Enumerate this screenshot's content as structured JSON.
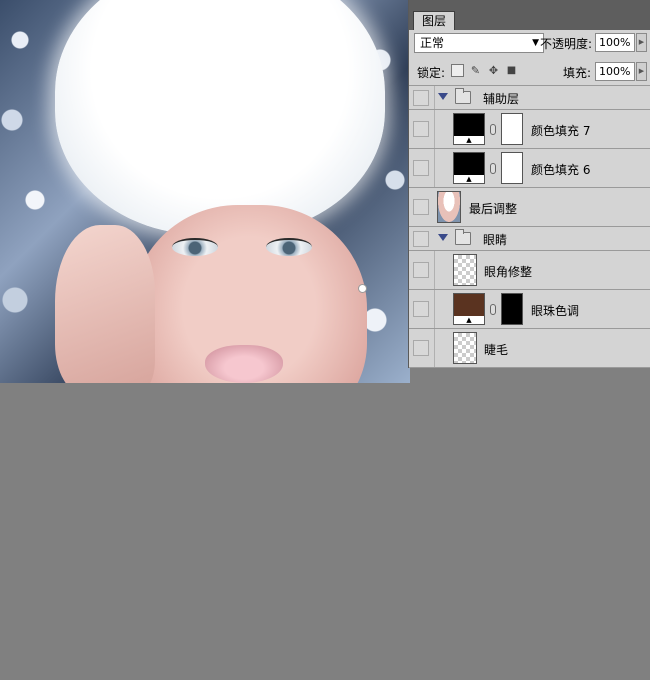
{
  "panel": {
    "tab_label": "图层",
    "blend_mode": "正常",
    "opacity_label": "不透明度:",
    "opacity_value": "100%",
    "lock_label": "锁定:",
    "fill_label": "填充:",
    "fill_value": "100%"
  },
  "layers": [
    {
      "name": "辅助层",
      "kind": "group"
    },
    {
      "name": "颜色填充 7",
      "kind": "fill"
    },
    {
      "name": "颜色填充 6",
      "kind": "fill"
    },
    {
      "name": "最后调整",
      "kind": "image"
    },
    {
      "name": "眼睛",
      "kind": "group"
    },
    {
      "name": "眼角修整",
      "kind": "pixel"
    },
    {
      "name": "眼珠色调",
      "kind": "fill",
      "color": "#5a3320"
    },
    {
      "name": "睫毛",
      "kind": "pixel"
    }
  ],
  "colors": {
    "workspace_bg": "#808080",
    "panel_bg": "#d4d4d4",
    "tab_bar": "#5e5e5e"
  }
}
